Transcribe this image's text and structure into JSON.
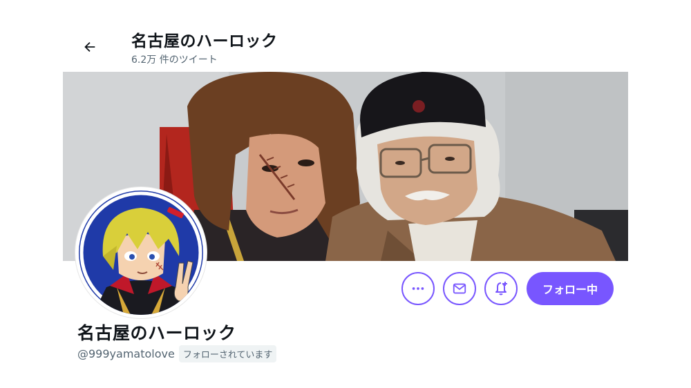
{
  "header": {
    "title": "名古屋のハーロック",
    "tweet_count": "6.2万 件のツイート",
    "back_icon": "arrow-left-icon"
  },
  "banner": {
    "alt": "Two men posing: one in a long brown wig with a scar, one in a black cap with a skull emblem"
  },
  "profile": {
    "display_name": "名古屋のハーロック",
    "handle": "@999yamatolove",
    "follows_you_label": "フォローされています"
  },
  "actions": {
    "more_icon": "more-dots-icon",
    "message_icon": "envelope-icon",
    "notify_icon": "bell-plus-icon",
    "follow_label": "フォロー中"
  },
  "colors": {
    "accent": "#7856ff",
    "text_primary": "#0f1419",
    "text_secondary": "#536471"
  }
}
